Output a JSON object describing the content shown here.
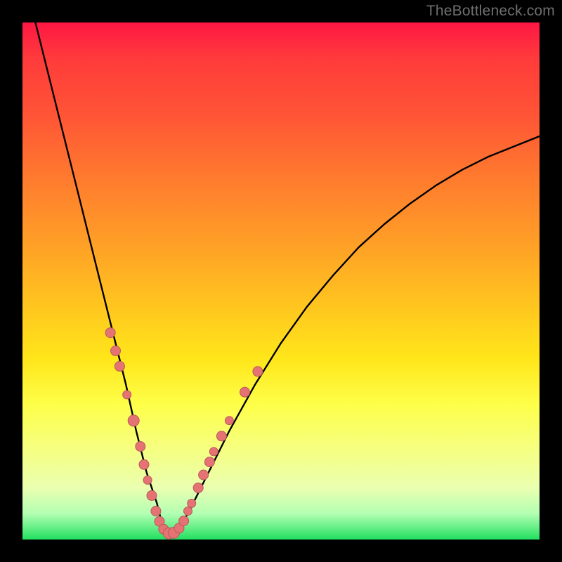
{
  "watermark": {
    "text": "TheBottleneck.com"
  },
  "gradient_colors": {
    "top": "#ff1744",
    "mid_orange": "#ff7a2e",
    "mid_yellow": "#ffe61a",
    "bottom": "#22e060"
  },
  "chart_data": {
    "type": "line",
    "title": "",
    "xlabel": "",
    "ylabel": "",
    "xlim": [
      0,
      100
    ],
    "ylim": [
      0,
      100
    ],
    "grid": false,
    "series": [
      {
        "name": "bottleneck-curve",
        "color": "#000000",
        "x": [
          2.5,
          5,
          8,
          11,
          14,
          17,
          20,
          22,
          24,
          26,
          27,
          28,
          29,
          30,
          32,
          35,
          40,
          45,
          50,
          55,
          60,
          65,
          70,
          75,
          80,
          85,
          90,
          95,
          100
        ],
        "y": [
          100,
          90,
          78,
          66,
          54,
          42,
          30,
          21,
          13,
          7,
          3,
          1,
          1,
          2,
          5,
          11,
          21,
          30,
          38,
          45,
          51,
          56.5,
          61,
          65,
          68.5,
          71.5,
          74,
          76,
          78
        ]
      }
    ],
    "scatter_overlay": {
      "name": "cluster-points",
      "color": "#e57373",
      "stroke": "#b85a5a",
      "points": [
        {
          "x": 17.0,
          "y": 40.0,
          "r": 7
        },
        {
          "x": 18.0,
          "y": 36.5,
          "r": 7
        },
        {
          "x": 18.8,
          "y": 33.5,
          "r": 7
        },
        {
          "x": 20.2,
          "y": 28.0,
          "r": 6
        },
        {
          "x": 21.5,
          "y": 23.0,
          "r": 8
        },
        {
          "x": 22.8,
          "y": 18.0,
          "r": 7
        },
        {
          "x": 23.5,
          "y": 14.5,
          "r": 7
        },
        {
          "x": 24.2,
          "y": 11.5,
          "r": 6
        },
        {
          "x": 25.0,
          "y": 8.5,
          "r": 7
        },
        {
          "x": 25.8,
          "y": 5.5,
          "r": 7
        },
        {
          "x": 26.5,
          "y": 3.5,
          "r": 7
        },
        {
          "x": 27.3,
          "y": 2.0,
          "r": 7
        },
        {
          "x": 28.3,
          "y": 1.2,
          "r": 8
        },
        {
          "x": 29.3,
          "y": 1.3,
          "r": 8
        },
        {
          "x": 30.3,
          "y": 2.2,
          "r": 7
        },
        {
          "x": 31.2,
          "y": 3.6,
          "r": 7
        },
        {
          "x": 32.0,
          "y": 5.5,
          "r": 6
        },
        {
          "x": 32.7,
          "y": 7.0,
          "r": 6
        },
        {
          "x": 34.0,
          "y": 10.0,
          "r": 7
        },
        {
          "x": 35.0,
          "y": 12.5,
          "r": 7
        },
        {
          "x": 36.2,
          "y": 15.0,
          "r": 7
        },
        {
          "x": 37.0,
          "y": 17.0,
          "r": 6
        },
        {
          "x": 38.5,
          "y": 20.0,
          "r": 7
        },
        {
          "x": 40.0,
          "y": 23.0,
          "r": 6
        },
        {
          "x": 43.0,
          "y": 28.5,
          "r": 7
        },
        {
          "x": 45.5,
          "y": 32.5,
          "r": 7
        }
      ]
    }
  }
}
